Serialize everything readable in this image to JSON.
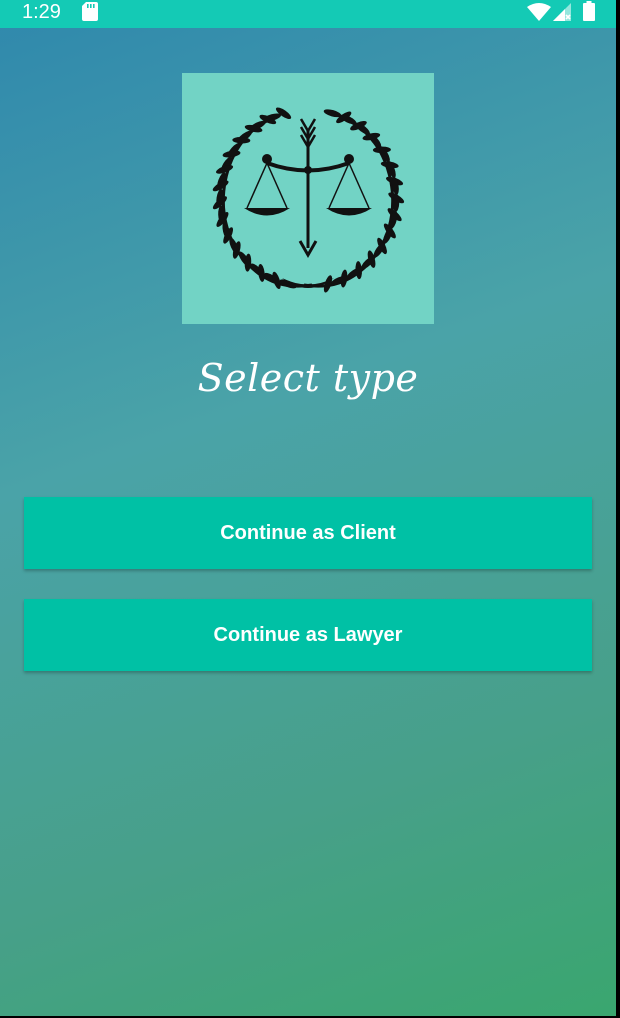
{
  "status_bar": {
    "time": "1:29",
    "icons": [
      "sd-card-icon",
      "wifi-icon",
      "signal-icon",
      "battery-icon"
    ]
  },
  "logo": {
    "icon": "scales-of-justice-wreath-icon",
    "background": "#72d3c5"
  },
  "title": "Select type",
  "buttons": {
    "client_label": "Continue as Client",
    "lawyer_label": "Continue as Lawyer"
  },
  "colors": {
    "status_bar": "#14cab5",
    "button": "#00c1a5",
    "gradient_start": "#2f88ad",
    "gradient_end": "#3aa66f"
  }
}
